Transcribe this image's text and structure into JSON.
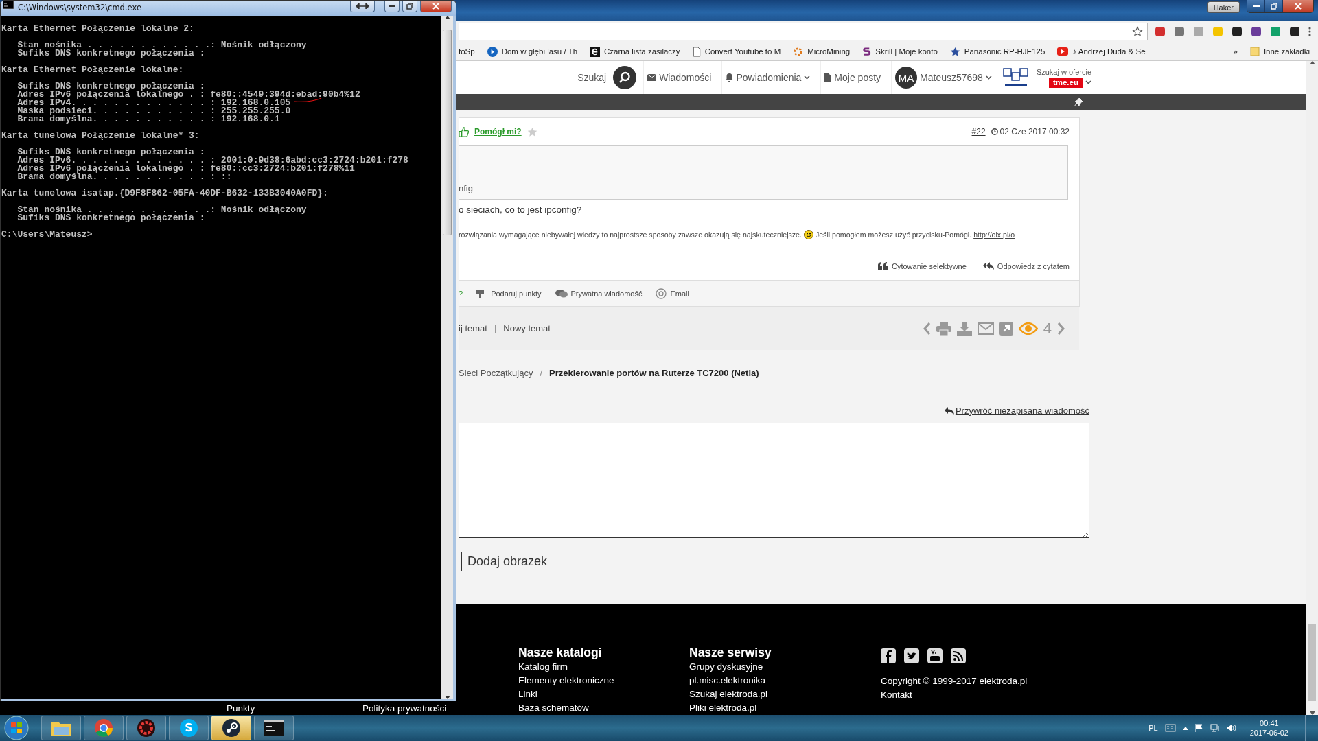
{
  "cmd_window": {
    "title": "C:\\Windows\\system32\\cmd.exe",
    "blocks": [
      {
        "heading": "Karta Ethernet Połączenie lokalne 2:",
        "entries": [
          "   Stan nośnika . . . . . . . . . . . .: Nośnik odłączony",
          "   Sufiks DNS konkretnego połączenia :"
        ]
      },
      {
        "heading": "Karta Ethernet Połączenie lokalne:",
        "entries": [
          "   Sufiks DNS konkretnego połączenia :",
          "   Adres IPv6 połączenia lokalnego . : fe80::4549:394d:ebad:90b4%12",
          "   Adres IPv4. . . . . . . . . . . . . : 192.168.0.105",
          "   Maska podsieci. . . . . . . . . . . : 255.255.255.0",
          "   Brama domyślna. . . . . . . . . . . : 192.168.0.1"
        ]
      },
      {
        "heading": "Karta tunelowa Połączenie lokalne* 3:",
        "entries": [
          "   Sufiks DNS konkretnego połączenia :",
          "   Adres IPv6. . . . . . . . . . . . . : 2001:0:9d38:6abd:cc3:2724:b201:f278",
          "   Adres IPv6 połączenia lokalnego . : fe80::cc3:2724:b201:f278%11",
          "   Brama domyślna. . . . . . . . . . . : ::"
        ]
      },
      {
        "heading": "Karta tunelowa isatap.{D9F8F862-05FA-40DF-B632-133B3040A0FD}:",
        "entries": [
          "   Stan nośnika . . . . . . . . . . . .: Nośnik odłączony",
          "   Sufiks DNS konkretnego połączenia :"
        ]
      }
    ],
    "prompt": "C:\\Users\\Mateusz>"
  },
  "browser": {
    "profile": "Haker",
    "bookmarks": [
      {
        "label": "foSp"
      },
      {
        "label": "Dom w głębi lasu / Th"
      },
      {
        "label": "Czarna lista zasilaczy"
      },
      {
        "label": "Convert Youtube to M"
      },
      {
        "label": "MicroMining"
      },
      {
        "label": "Skrill | Moje konto"
      },
      {
        "label": "Panasonic RP-HJE125"
      },
      {
        "label": "♪ Andrzej Duda & Se"
      }
    ],
    "overflow": "»",
    "other_bookmarks": "Inne zakładki"
  },
  "site_header": {
    "search_label": "Szukaj",
    "nav": [
      {
        "label": "Wiadomości",
        "dropdown": false
      },
      {
        "label": "Powiadomienia",
        "dropdown": true
      },
      {
        "label": "Moje posty",
        "dropdown": false
      }
    ],
    "user": {
      "initials": "MA",
      "name": "Mateusz57698"
    },
    "shop_search": {
      "label": "Szukaj w ofercie",
      "badge": "tme.eu"
    }
  },
  "post": {
    "helped": "Pomógł mi?",
    "number": "#22",
    "date": "02 Cze 2017 00:32",
    "quote": "nfig",
    "text": "o sieciach, co to jest ipconfig?",
    "signature": {
      "first": "rozwiązania wymagające niebywałej wiedzy to najprostsze sposoby zawsze okazują się najskuteczniejsze.",
      "second": "Jeśli pomogłem możesz użyć przycisku-Pomógł.",
      "link": "http://olx.pl/o"
    },
    "quote_actions": [
      "Cytowanie selektywne",
      "Odpowiedz z cytatem"
    ],
    "footer_actions": [
      {
        "label": "?",
        "kind": "help"
      },
      {
        "label": "Podaruj punkty",
        "kind": "points"
      },
      {
        "label": "Prywatna wiadomość",
        "kind": "message"
      },
      {
        "label": "Email",
        "kind": "email"
      }
    ]
  },
  "topic_bar": {
    "links": [
      "ij temat",
      "Nowy temat"
    ],
    "separator": "|",
    "views": "4"
  },
  "breadcrumb": {
    "parent": "Sieci Początkujący",
    "separator": "/",
    "current": "Przekierowanie portów na Ruterze TC7200 (Netia)"
  },
  "reply": {
    "restore": "Przywróć niezapisana wiadomość",
    "add_image": "Dodaj obrazek"
  },
  "footer": {
    "columns": [
      {
        "links": [
          "Punkty"
        ]
      },
      {
        "links": [
          "Polityka prywatności"
        ]
      },
      {
        "heading": "Nasze katalogi",
        "links": [
          "Katalog firm",
          "Elementy elektroniczne",
          "Linki",
          "Baza schematów"
        ]
      },
      {
        "heading": "Nasze serwisy",
        "links": [
          "Grupy dyskusyjne",
          "pl.misc.elektronika",
          "Szukaj elektroda.pl",
          "Pliki elektroda.pl"
        ]
      }
    ],
    "copyright": "Copyright © 1999-2017 elektroda.pl",
    "contact": "Kontakt"
  },
  "taskbar": {
    "buttons": [
      {
        "highlighted": false
      },
      {
        "highlighted": false
      },
      {
        "highlighted": false
      },
      {
        "highlighted": false
      },
      {
        "highlighted": true
      },
      {
        "highlighted": false
      }
    ],
    "language": "PL",
    "time": "00:41",
    "date": "2017-06-02"
  }
}
